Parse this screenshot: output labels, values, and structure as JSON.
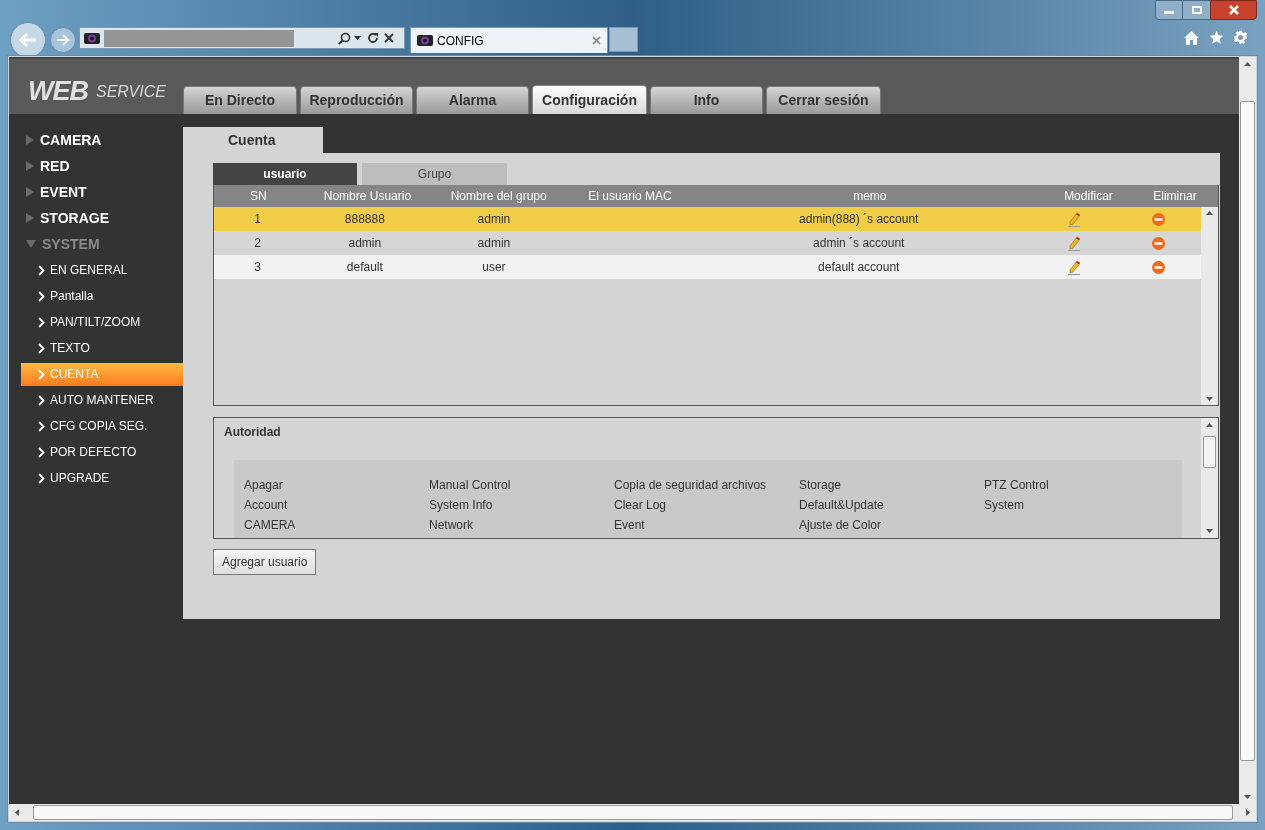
{
  "browser": {
    "tab_title": "CONFIG"
  },
  "logo": {
    "main": "WEB",
    "sub": "SERVICE"
  },
  "nav_tabs": [
    {
      "label": "En Directo",
      "selected": false
    },
    {
      "label": "Reproducción",
      "selected": false
    },
    {
      "label": "Alarma",
      "selected": false
    },
    {
      "label": "Configuración",
      "selected": true
    },
    {
      "label": "Info",
      "selected": false
    },
    {
      "label": "Cerrar sesión",
      "selected": false
    }
  ],
  "sidebar": {
    "items": [
      {
        "label": "CAMERA",
        "expanded": false
      },
      {
        "label": "RED",
        "expanded": false
      },
      {
        "label": "EVENT",
        "expanded": false
      },
      {
        "label": "STORAGE",
        "expanded": false
      },
      {
        "label": "SYSTEM",
        "expanded": true,
        "children": [
          {
            "label": "EN GENERAL",
            "selected": false
          },
          {
            "label": "Pantalla",
            "selected": false
          },
          {
            "label": "PAN/TILT/ZOOM",
            "selected": false
          },
          {
            "label": "TEXTO",
            "selected": false
          },
          {
            "label": "CUENTA",
            "selected": true
          },
          {
            "label": "AUTO MANTENER",
            "selected": false
          },
          {
            "label": "CFG COPIA SEG.",
            "selected": false
          },
          {
            "label": "POR DEFECTO",
            "selected": false
          },
          {
            "label": "UPGRADE",
            "selected": false
          }
        ]
      }
    ]
  },
  "page_tab": "Cuenta",
  "sub_tabs": [
    {
      "label": "usuario",
      "selected": true
    },
    {
      "label": "Grupo",
      "selected": false
    }
  ],
  "table": {
    "columns": [
      "SN",
      "Nombre Usuario",
      "Nombre del grupo",
      "El usuario MAC",
      "memo",
      "Modificar",
      "Eliminar"
    ],
    "rows": [
      {
        "sn": "1",
        "user": "888888",
        "group": "admin",
        "memo": "admin(888) ´s account",
        "selected": true
      },
      {
        "sn": "2",
        "user": "admin",
        "group": "admin",
        "memo": "admin ´s account",
        "selected": false
      },
      {
        "sn": "3",
        "user": "default",
        "group": "user",
        "memo": "default account",
        "selected": false
      }
    ]
  },
  "authority": {
    "title": "Autoridad",
    "items": [
      "Apagar",
      "Manual Control",
      "Copia de seguridad archivos",
      "Storage",
      "PTZ Control",
      "Account",
      "System Info",
      "Clear Log",
      "Default&Update",
      "System",
      "CAMERA",
      "Network",
      "Event",
      "Ajuste de Color"
    ]
  },
  "add_button": "Agregar usuario"
}
